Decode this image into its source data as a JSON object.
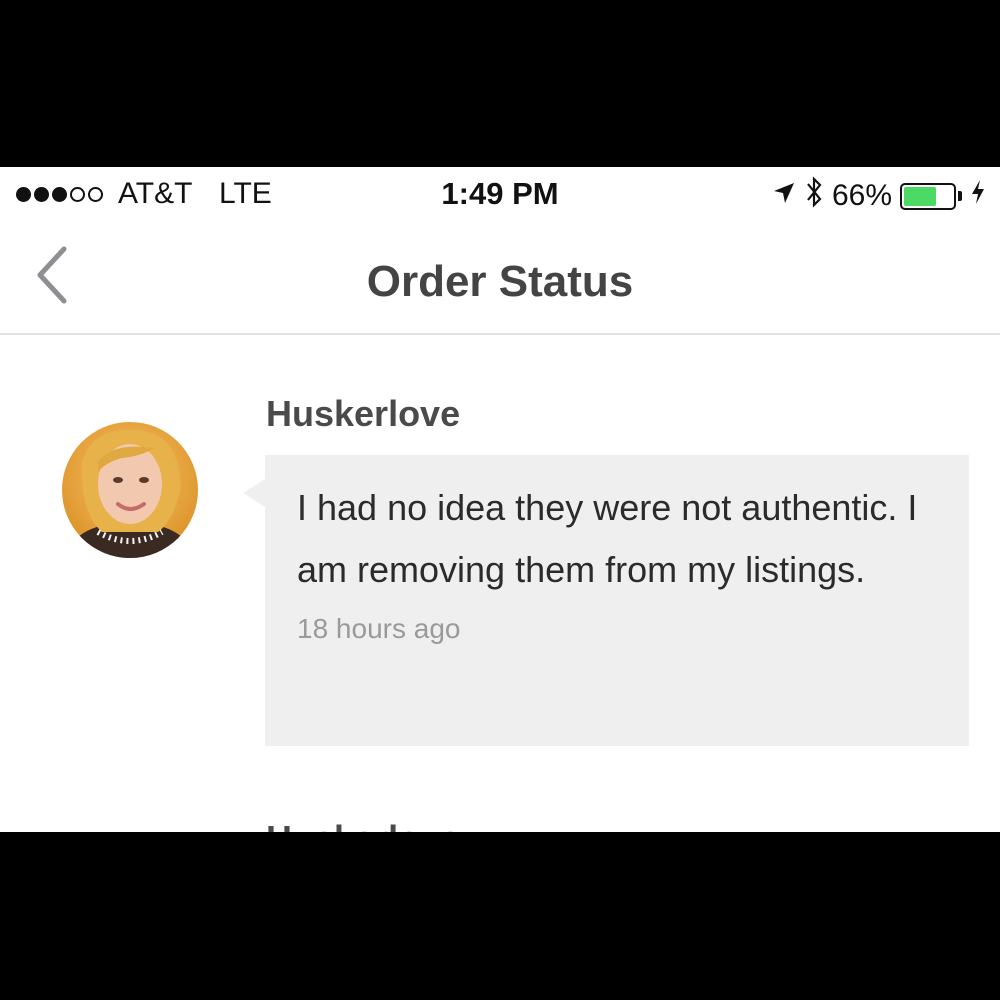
{
  "status_bar": {
    "signal_filled": 3,
    "signal_total": 5,
    "carrier": "AT&T",
    "network": "LTE",
    "time": "1:49 PM",
    "battery_percent": "66%",
    "battery_level": 0.66,
    "battery_color": "#4cd964",
    "icons": [
      "location-arrow-icon",
      "bluetooth-icon",
      "battery-icon",
      "charging-bolt-icon"
    ]
  },
  "navbar": {
    "title": "Order Status",
    "back_icon": "chevron-left-icon"
  },
  "messages": [
    {
      "username": "Huskerlove",
      "text": "I had no idea they were not authentic. I am removing them from my listings.",
      "time_ago": "18 hours ago"
    }
  ],
  "next_message_username": "Huskerlove"
}
